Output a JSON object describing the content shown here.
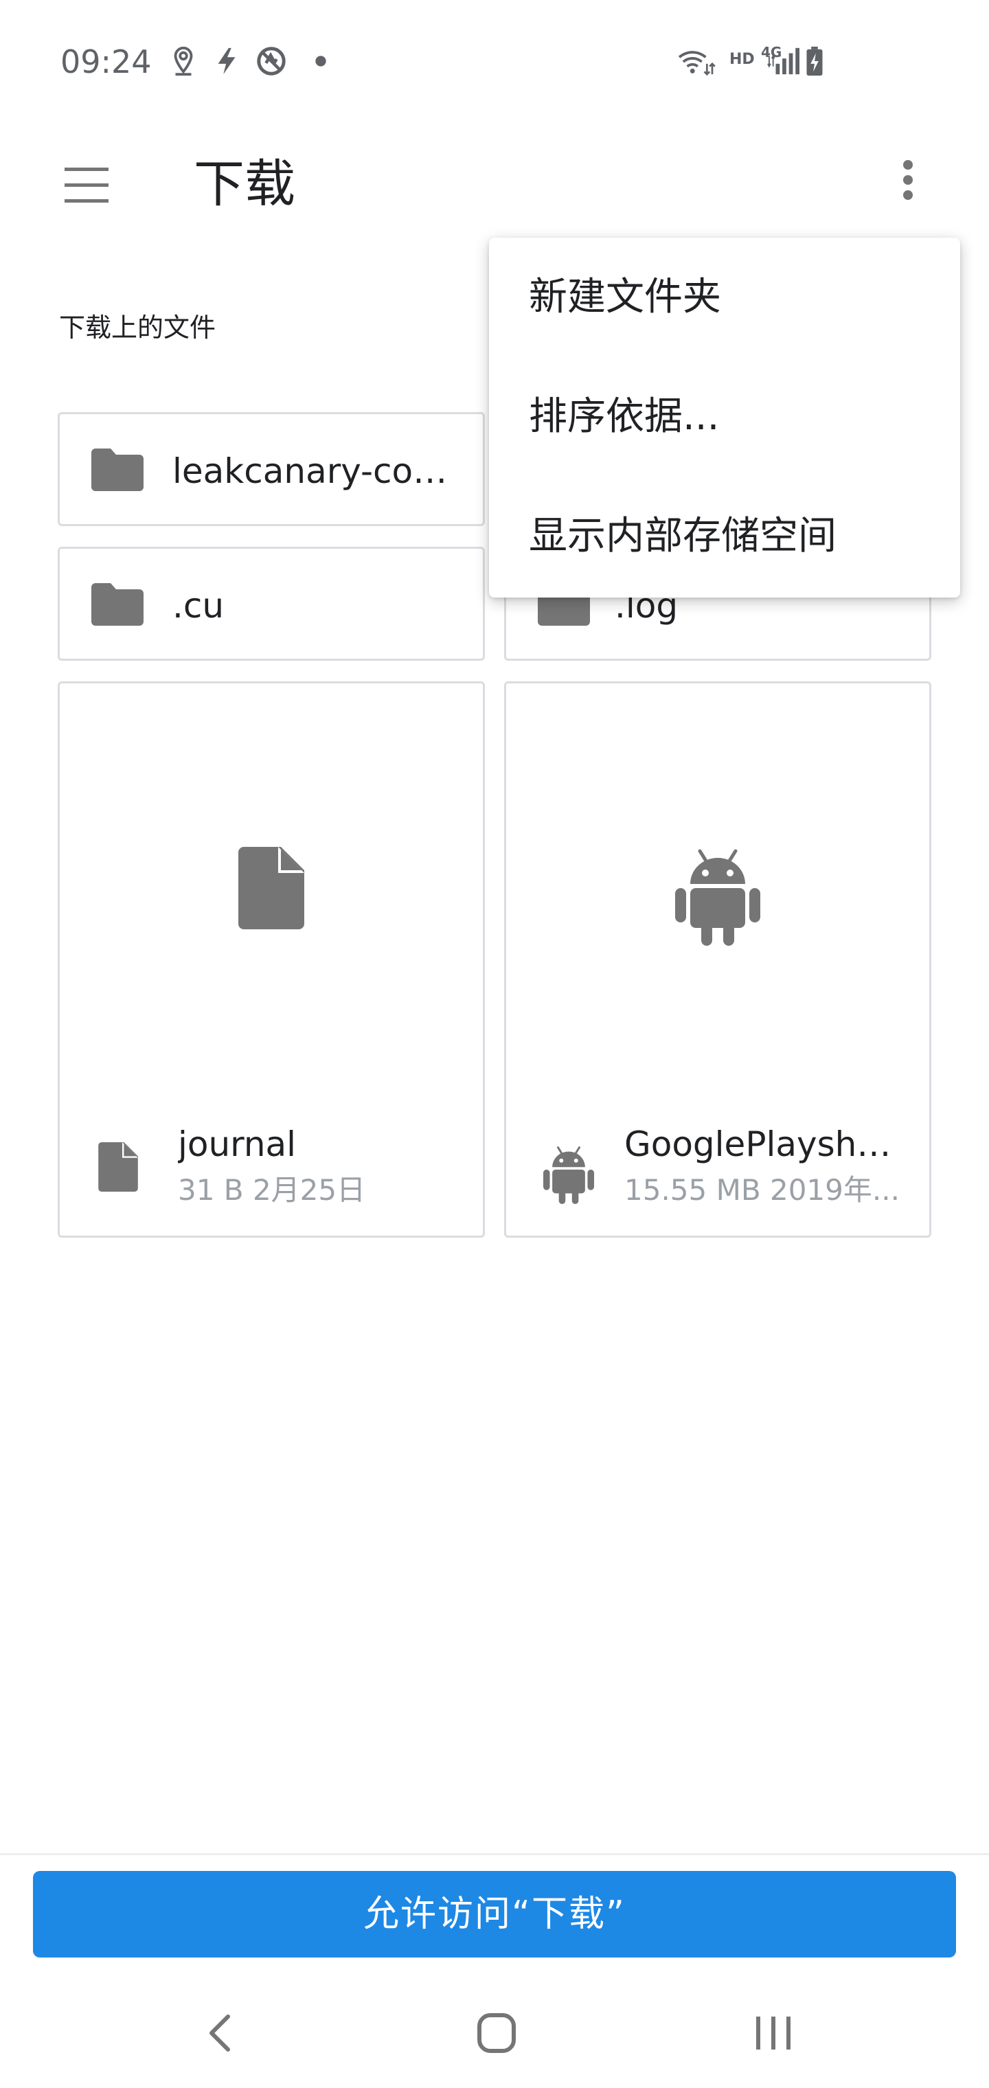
{
  "status_bar": {
    "time": "09:24",
    "network_label": "HD",
    "cell_label": "4G",
    "icons": [
      "location-icon",
      "flash-icon",
      "no-disturb-icon",
      "dot-icon",
      "wifi-icon",
      "signal-icon",
      "battery-charging-icon"
    ]
  },
  "toolbar": {
    "title": "下载",
    "menu_icon": "hamburger-menu-icon",
    "more_icon": "more-vert-icon"
  },
  "section_label": "下载上的文件",
  "folders": [
    {
      "name": "leakcanary-com..."
    },
    {
      "name": ".cu"
    },
    {
      "name": ".log"
    }
  ],
  "files": [
    {
      "name": "journal",
      "meta": "31 B 2月25日",
      "icon": "file-icon"
    },
    {
      "name": "GooglePlaysha...",
      "meta": "15.55 MB 2019年...",
      "icon": "android-icon"
    }
  ],
  "popup_menu": {
    "items": [
      {
        "label": "新建文件夹"
      },
      {
        "label": "排序依据..."
      },
      {
        "label": "显示内部存储空间"
      }
    ]
  },
  "allow_button": {
    "label": "允许访问“下载”"
  },
  "colors": {
    "accent": "#1e88e5",
    "icon_gray": "#757575",
    "border": "#dadce0"
  },
  "nav_bar": {
    "icons": [
      "back-icon",
      "home-icon",
      "recents-icon"
    ]
  }
}
